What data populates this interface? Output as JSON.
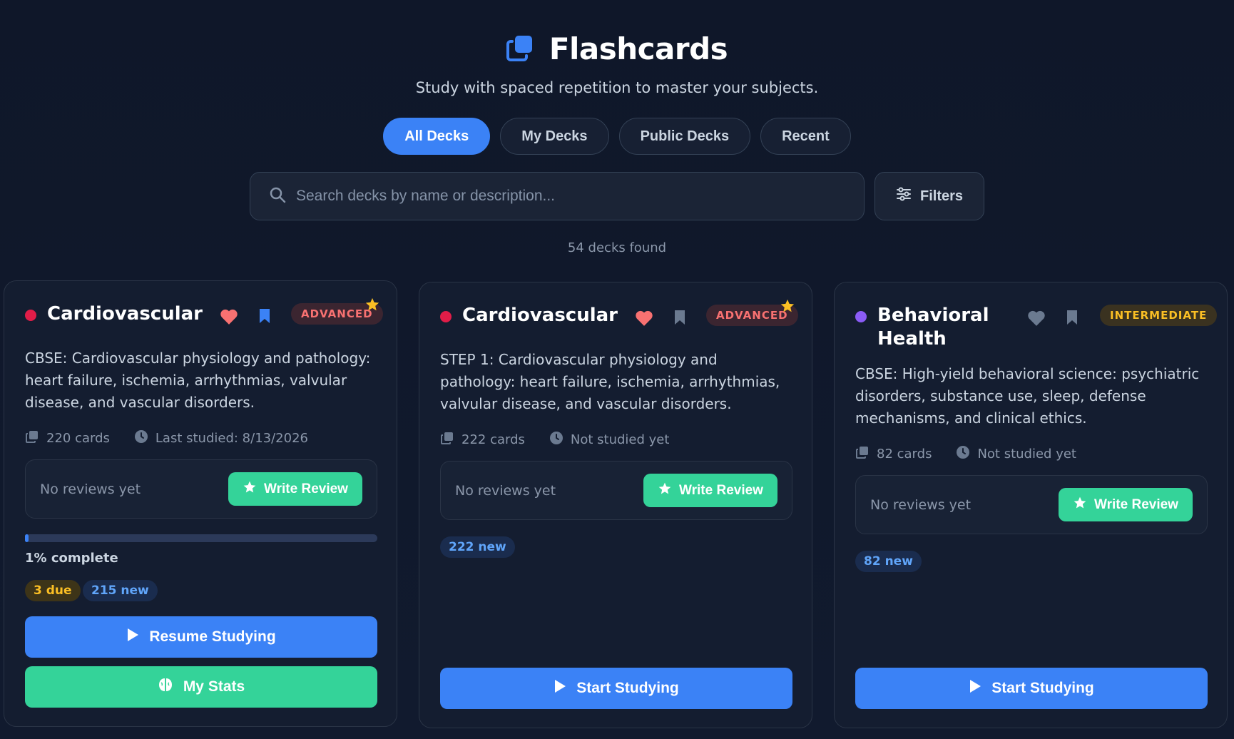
{
  "header": {
    "title": "Flashcards",
    "subtitle": "Study with spaced repetition to master your subjects.",
    "logo_icon": "cards-stack-icon"
  },
  "tabs": [
    {
      "label": "All Decks",
      "active": true
    },
    {
      "label": "My Decks",
      "active": false
    },
    {
      "label": "Public Decks",
      "active": false
    },
    {
      "label": "Recent",
      "active": false
    }
  ],
  "search": {
    "placeholder": "Search decks by name or description...",
    "value": "",
    "filters_label": "Filters"
  },
  "results": {
    "count_text": "54 decks found"
  },
  "colors": {
    "accent_blue": "#3b82f6",
    "accent_green": "#34d399",
    "heart_red": "#f87171",
    "advanced_text": "#f87171",
    "intermediate_text": "#fbbf24",
    "dot_red": "#e11d48",
    "dot_purple": "#8b5cf6"
  },
  "decks": [
    {
      "name": "Cardiovascular",
      "difficulty": "ADVANCED",
      "featured": true,
      "favorited": true,
      "bookmarked": true,
      "description": "CBSE: Cardiovascular physiology and pathology: heart failure, ischemia, arrhythmias, valvular disease, and vascular disorders.",
      "cards": "220 cards",
      "studied": "Last studied: 8/13/2026",
      "reviews": "No reviews yet",
      "write_review": "Write Review",
      "progress_percent": 1,
      "progress_label": "1% complete",
      "due": "3 due",
      "new": "215 new",
      "primary_action": "Resume Studying",
      "secondary_action": "My Stats"
    },
    {
      "name": "Cardiovascular",
      "difficulty": "ADVANCED",
      "featured": true,
      "favorited": true,
      "bookmarked": false,
      "description": "STEP 1: Cardiovascular physiology and pathology: heart failure, ischemia, arrhythmias, valvular disease, and vascular disorders.",
      "cards": "222 cards",
      "studied": "Not studied yet",
      "reviews": "No reviews yet",
      "write_review": "Write Review",
      "new": "222 new",
      "primary_action": "Start Studying"
    },
    {
      "name": "Behavioral Health",
      "difficulty": "INTERMEDIATE",
      "featured": false,
      "favorited": false,
      "bookmarked": false,
      "description": "CBSE: High-yield behavioral science: psychiatric disorders, substance use, sleep, defense mechanisms, and clinical ethics.",
      "cards": "82 cards",
      "studied": "Not studied yet",
      "reviews": "No reviews yet",
      "write_review": "Write Review",
      "new": "82 new",
      "primary_action": "Start Studying"
    }
  ]
}
